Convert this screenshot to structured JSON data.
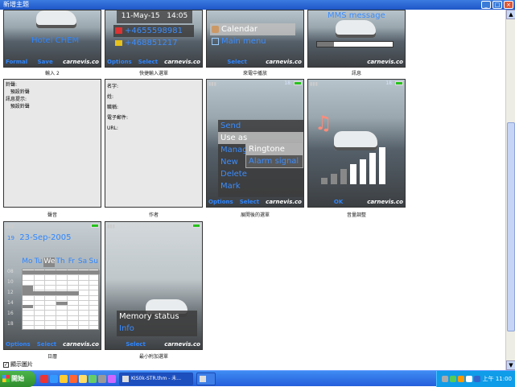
{
  "window": {
    "title": "新增主題",
    "minimize": "_",
    "maximize": "□",
    "close": "×"
  },
  "row1": {
    "tile1": {
      "text": "Hotel CHEM",
      "left_key": "Formal",
      "mid_key": "Save",
      "brand": "carnevis.co",
      "caption": "輸入 2"
    },
    "tile2": {
      "date": "11-May-15",
      "time": "14:05",
      "phone1": "+4655598981",
      "phone2": "+468851217",
      "left_key": "Options",
      "mid_key": "Select",
      "brand": "carnevis.co",
      "caption": "快捷輸入選單"
    },
    "tile3": {
      "item1": "Calendar",
      "item2": "Main menu",
      "mid_key": "Select",
      "brand": "carnevis.co",
      "caption": "來電中播放"
    },
    "tile4": {
      "text": "MMS message",
      "brand": "carnevis.co",
      "caption": "訊息"
    }
  },
  "row2": {
    "panel1": {
      "lines": [
        "鈴聲:",
        "   預設鈴聲",
        "訊息提示:",
        "   預設鈴聲"
      ],
      "caption": "聲音"
    },
    "panel2": {
      "lines": [
        "名字:",
        "",
        "姓:",
        "",
        "職稱:",
        "",
        "電子郵件:",
        "",
        "URL:"
      ],
      "caption": "作者"
    },
    "tile3": {
      "time": "18:",
      "menu": [
        "Send",
        "Use as",
        "Manage",
        "New",
        "Delete",
        "Mark"
      ],
      "submenu": [
        "Ringtone",
        "Alarm signal"
      ],
      "left_key": "Options",
      "mid_key": "Select",
      "brand": "carnevis.co",
      "caption": "展開後的選單"
    },
    "tile4": {
      "time": "18:",
      "ok_key": "OK",
      "brand": "carnevis.co",
      "caption": "音量調整",
      "volume_bars": [
        0.15,
        0.25,
        0.38,
        0.5,
        0.62,
        0.78,
        0.92
      ],
      "note_icon": "music-note-icon"
    }
  },
  "row3": {
    "tile1": {
      "week": "19",
      "date": "23-Sep-2005",
      "days": [
        "Mo",
        "Tu",
        "We",
        "Th",
        "Fr",
        "Sa",
        "Su"
      ],
      "hours": [
        "08",
        "10",
        "12",
        "14",
        "16",
        "18"
      ],
      "left_key": "Options",
      "mid_key": "Select",
      "brand": "carnevis.co",
      "caption": "日曆"
    },
    "tile2": {
      "menu": [
        "Memory status",
        "Info"
      ],
      "mid_key": "Select",
      "brand": "carnevis.co",
      "caption": "最小附加選單"
    }
  },
  "checkbox": {
    "label": "顯示圖片",
    "checked": true
  },
  "taskbar": {
    "start": "開始",
    "task1": "KIS0k-STR.thm - 未...",
    "task2": "",
    "clock": "上午 11:00"
  },
  "colors": {
    "softkey": "#2f86ff",
    "titlebar": "#245edb",
    "battery": "#26c21d"
  }
}
